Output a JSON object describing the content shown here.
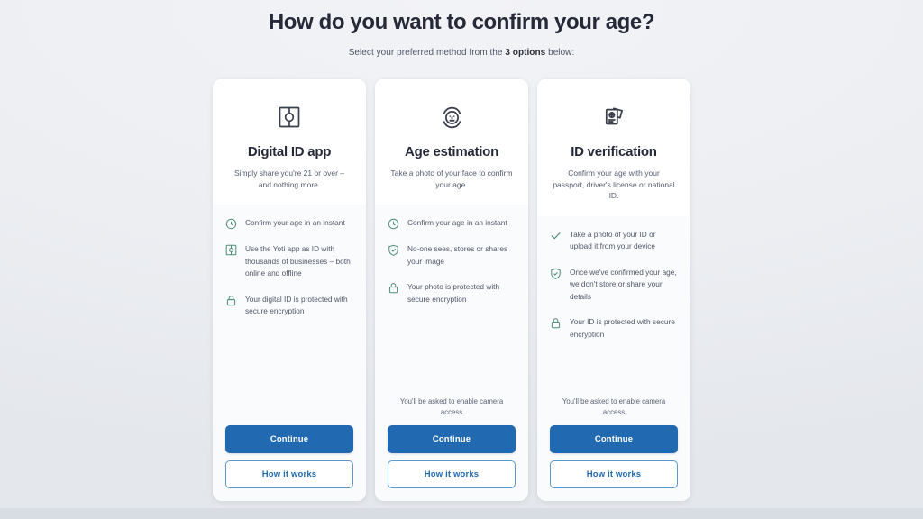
{
  "header": {
    "title": "How do you want to confirm your age?",
    "subtitle_before": "Select your preferred method from the ",
    "subtitle_strong": "3 options",
    "subtitle_after": " below:"
  },
  "colors": {
    "primary_blue": "#2169b0",
    "secondary_border": "#5d97c9",
    "feature_icon_green": "#4e8d74",
    "title_dark": "#262a38",
    "body_text": "#4f5668",
    "page_background": "#eceef2",
    "card_background": "#ffffff"
  },
  "cards": [
    {
      "icon": "digital-id-square-icon",
      "title": "Digital ID app",
      "description": "Simply share you're 21 or over – and nothing more.",
      "features": [
        {
          "icon": "clock-icon",
          "text": "Confirm your age in an instant"
        },
        {
          "icon": "digital-id-square-icon",
          "text": "Use the Yoti app as ID with thousands of businesses – both online and offline"
        },
        {
          "icon": "lock-icon",
          "text": "Your digital ID is protected with secure encryption"
        }
      ],
      "note": "",
      "primary_button": "Continue",
      "secondary_button": "How it works"
    },
    {
      "icon": "face-scan-icon",
      "title": "Age estimation",
      "description": "Take a photo of your face to confirm your age.",
      "features": [
        {
          "icon": "clock-icon",
          "text": "Confirm your age in an instant"
        },
        {
          "icon": "shield-check-icon",
          "text": "No-one sees, stores or shares your image"
        },
        {
          "icon": "lock-icon",
          "text": "Your photo is protected with secure encryption"
        }
      ],
      "note": "You'll be asked to enable camera access",
      "primary_button": "Continue",
      "secondary_button": "How it works"
    },
    {
      "icon": "id-documents-icon",
      "title": "ID verification",
      "description": "Confirm your age with your passport, driver's license or national ID.",
      "features": [
        {
          "icon": "check-icon",
          "text": "Take a photo of your ID or upload it from your device"
        },
        {
          "icon": "shield-check-icon",
          "text": "Once we've confirmed your age, we don't store or share your details"
        },
        {
          "icon": "lock-icon",
          "text": "Your ID is protected with secure encryption"
        }
      ],
      "note": "You'll be asked to enable camera access",
      "primary_button": "Continue",
      "secondary_button": "How it works"
    }
  ]
}
